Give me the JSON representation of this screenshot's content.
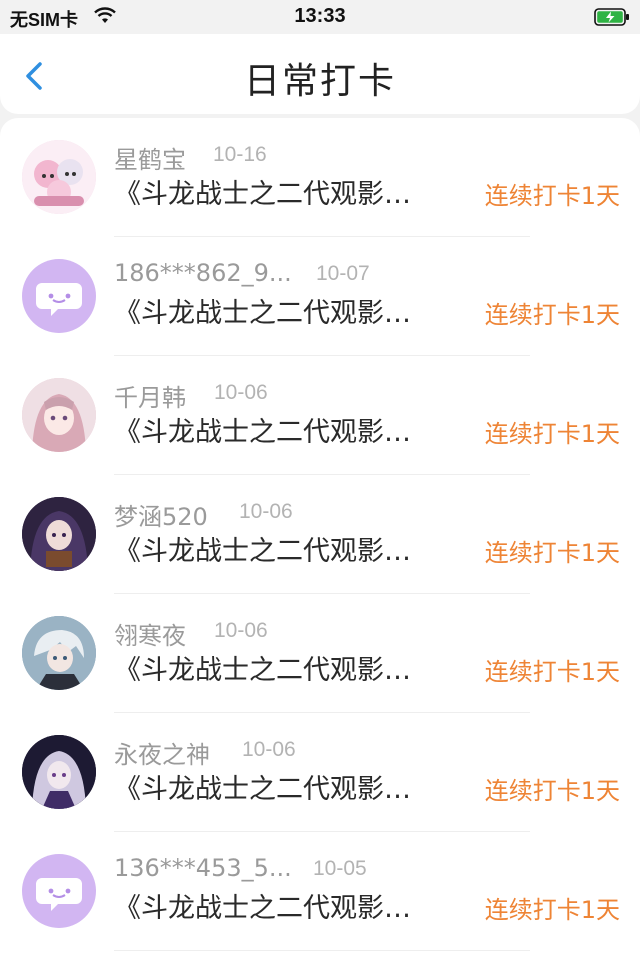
{
  "status_bar": {
    "carrier": "无SIM卡",
    "time": "13:33",
    "accent_battery_color": "#2fb344"
  },
  "header": {
    "title": "日常打卡",
    "back_icon": "chevron-left-icon",
    "accent_color": "#2f8fe0"
  },
  "checkins": [
    {
      "name": "星鹤宝",
      "date": "10-16",
      "book": "《斗龙战士之二代观影…",
      "streak": "连续打卡1天",
      "avatar": "anime-group",
      "avatar_color": "#f3d6e6"
    },
    {
      "name": "186***862_9...",
      "date": "10-07",
      "book": "《斗龙战士之二代观影…",
      "streak": "连续打卡1天",
      "avatar": "default-chat-icon",
      "avatar_color": "#d2b6f2"
    },
    {
      "name": "千月韩",
      "date": "10-06",
      "book": "《斗龙战士之二代观影…",
      "streak": "连续打卡1天",
      "avatar": "anime-girl-pink",
      "avatar_color": "#e8c7cf"
    },
    {
      "name": "梦涵520",
      "date": "10-06",
      "book": "《斗龙战士之二代观影…",
      "streak": "连续打卡1天",
      "avatar": "anime-girl-dark",
      "avatar_color": "#3b2a4e"
    },
    {
      "name": "翎寒夜",
      "date": "10-06",
      "book": "《斗龙战士之二代观影…",
      "streak": "连续打卡1天",
      "avatar": "anime-boy-silver",
      "avatar_color": "#7e9bb0"
    },
    {
      "name": "永夜之神",
      "date": "10-06",
      "book": "《斗龙战士之二代观影…",
      "streak": "连续打卡1天",
      "avatar": "anime-night",
      "avatar_color": "#24213d"
    },
    {
      "name": "136***453_5...",
      "date": "10-05",
      "book": "《斗龙战士之二代观影…",
      "streak": "连续打卡1天",
      "avatar": "default-chat-icon",
      "avatar_color": "#d2b6f2"
    }
  ],
  "streak_color": "#ee8435"
}
